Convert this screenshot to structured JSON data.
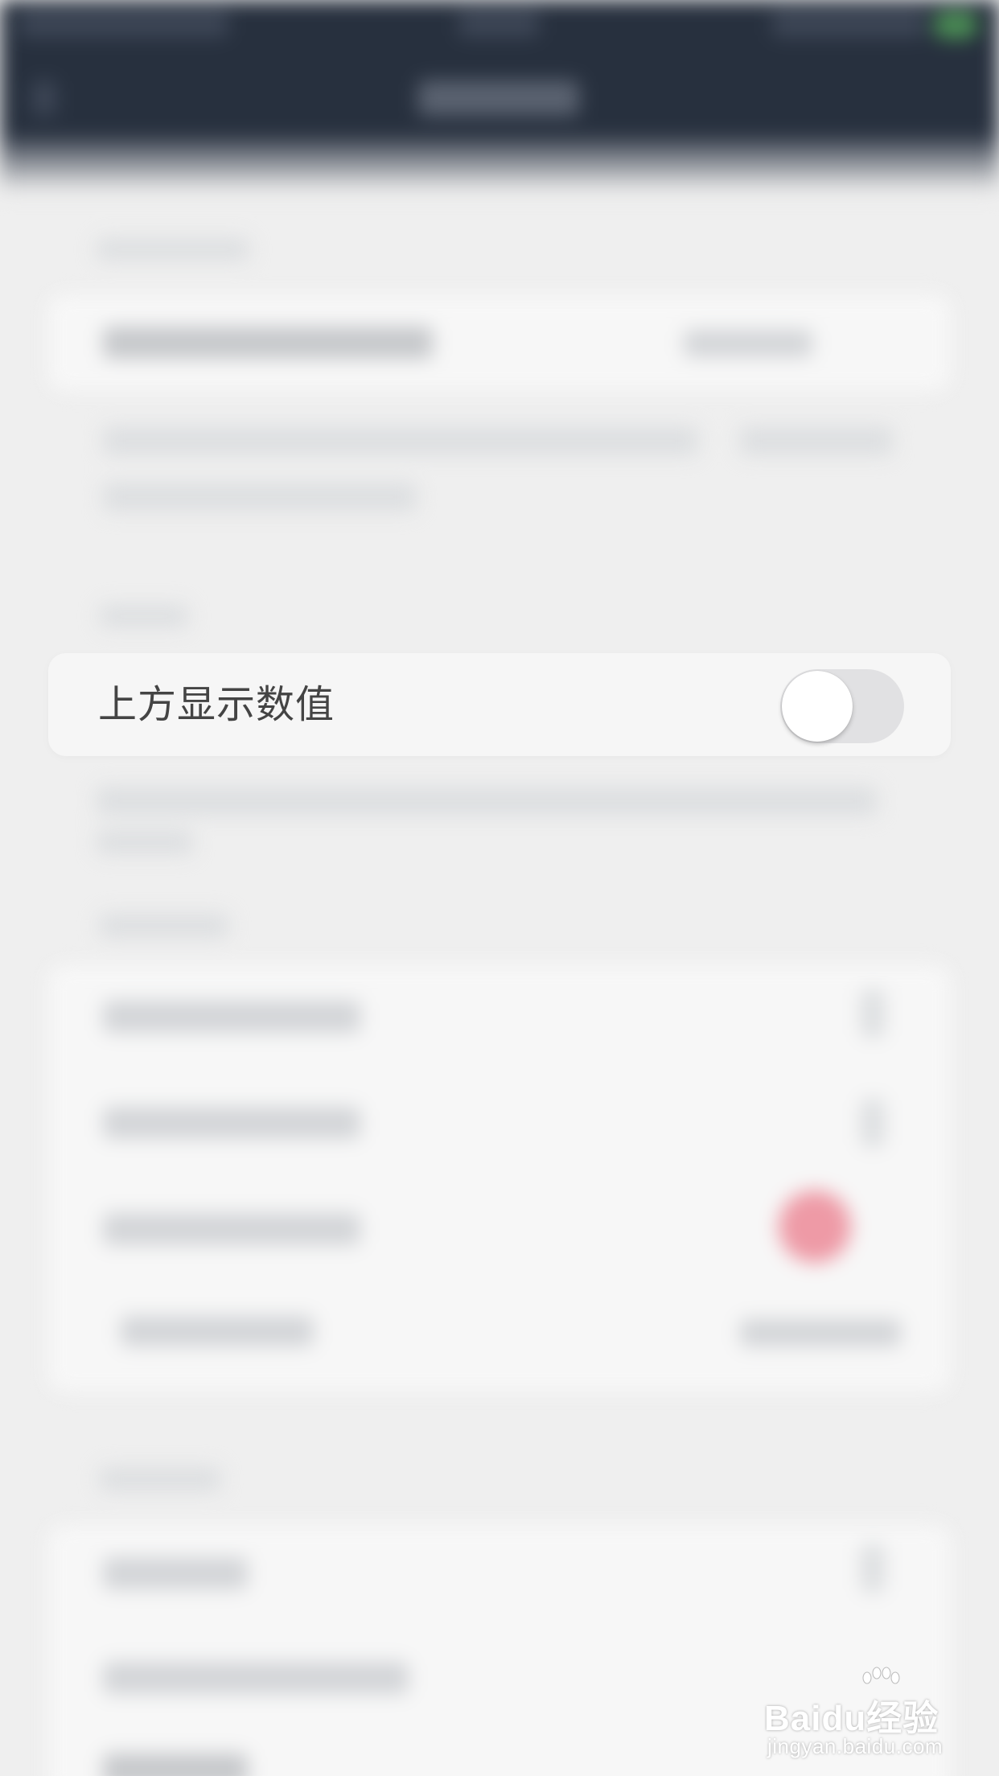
{
  "settings": {
    "show_value_above_label": "上方显示数值",
    "show_value_above_on": false
  },
  "watermark": {
    "logo": "Baidu经验",
    "url": "jingyan.baidu.com"
  },
  "colors": {
    "navbar": "#27303e",
    "background": "#efefef",
    "card": "#f7f7f7",
    "switch_off_track": "#e1e1e3",
    "badge_red": "#ee9aa6"
  }
}
